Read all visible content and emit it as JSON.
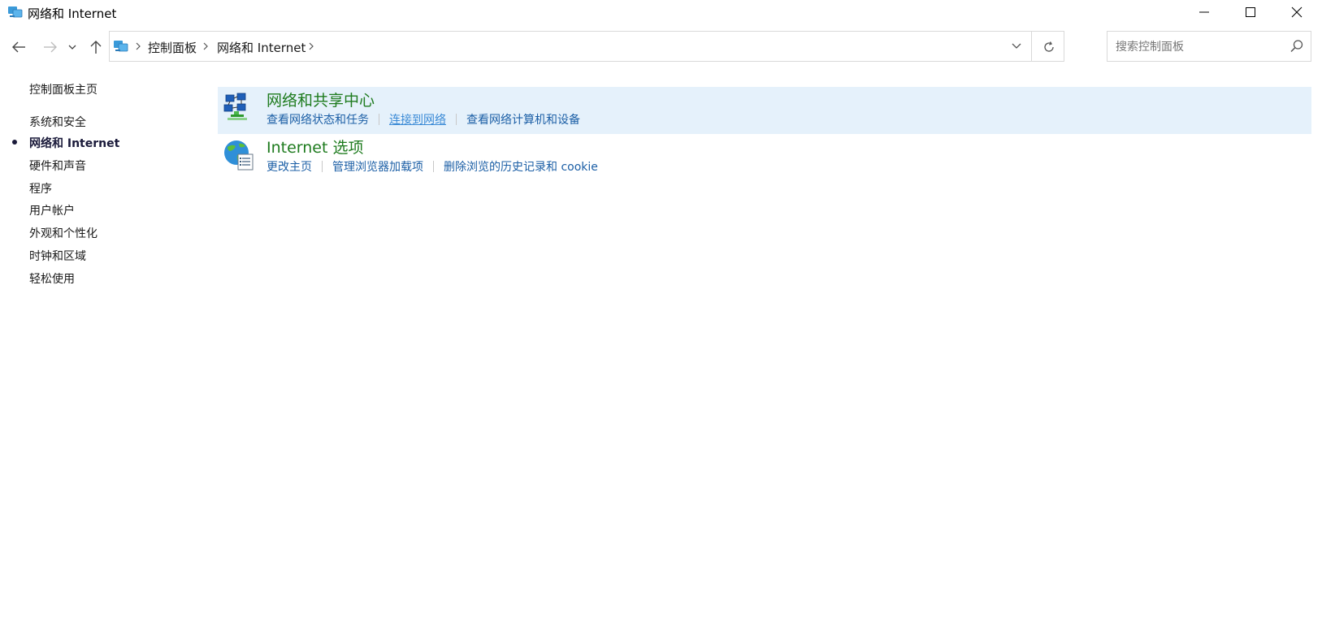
{
  "window": {
    "title": "网络和 Internet",
    "minimize_icon": "minimize-icon",
    "maximize_icon": "maximize-icon",
    "close_icon": "close-icon"
  },
  "nav": {
    "back_icon": "back-arrow-icon",
    "forward_icon": "forward-arrow-icon",
    "recent_icon": "chevron-down-icon",
    "up_icon": "up-arrow-icon"
  },
  "address": {
    "breadcrumbs": [
      "控制面板",
      "网络和 Internet"
    ],
    "refresh_icon": "refresh-icon"
  },
  "search": {
    "placeholder": "搜索控制面板",
    "icon": "search-icon"
  },
  "sidebar": {
    "home": "控制面板主页",
    "items": [
      {
        "label": "系统和安全"
      },
      {
        "label": "网络和 Internet",
        "active": true
      },
      {
        "label": "硬件和声音"
      },
      {
        "label": "程序"
      },
      {
        "label": "用户帐户"
      },
      {
        "label": "外观和个性化"
      },
      {
        "label": "时钟和区域"
      },
      {
        "label": "轻松使用"
      }
    ]
  },
  "categories": [
    {
      "title": "网络和共享中心",
      "icon": "network-sharing-icon",
      "highlighted": true,
      "links": [
        "查看网络状态和任务",
        "连接到网络",
        "查看网络计算机和设备"
      ],
      "hover_link": 1
    },
    {
      "title": "Internet 选项",
      "icon": "internet-globe-icon",
      "highlighted": false,
      "links": [
        "更改主页",
        "管理浏览器加载项",
        "删除浏览的历史记录和 cookie"
      ]
    }
  ],
  "colors": {
    "category_title": "#1e7b1e",
    "link": "#1c5fa6",
    "link_hover": "#3a8ad6",
    "highlight_bg": "#e5f1fb"
  }
}
